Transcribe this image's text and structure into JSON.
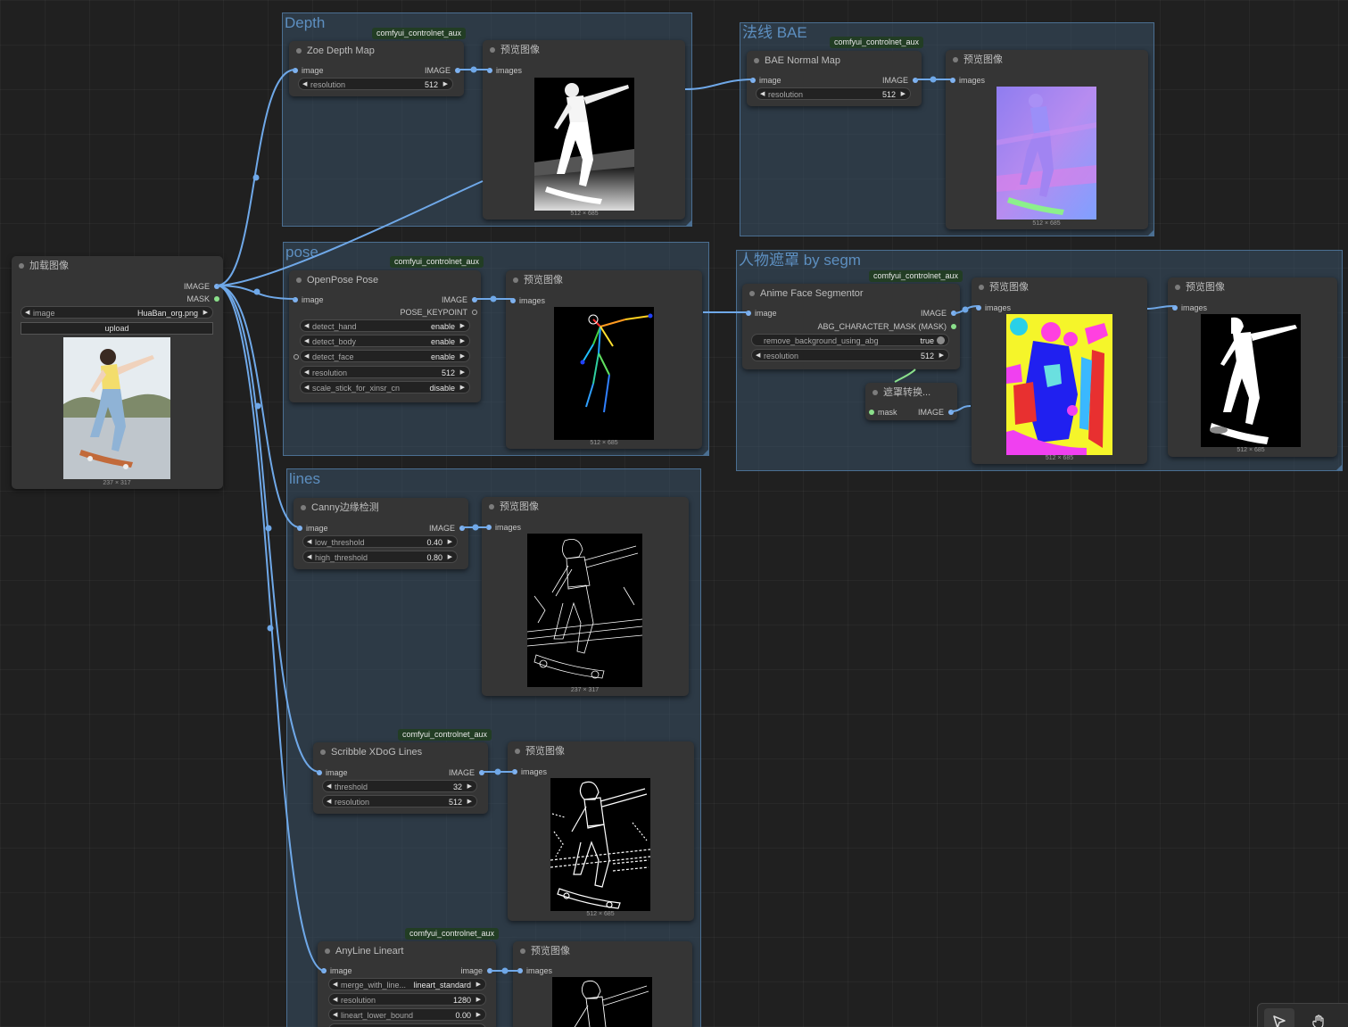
{
  "colors": {
    "canvas": "#202020",
    "group": "#395066",
    "group_title": "#5d8fc0",
    "node": "#353535",
    "link": "#6fa8e8",
    "badge": "#223d24"
  },
  "groups": {
    "depth": "Depth",
    "normal": "法线 BAE",
    "pose": "pose",
    "segm": "人物遮罩 by segm",
    "lines": "lines"
  },
  "badges": {
    "depth": "comfyui_controlnet_aux",
    "normal": "comfyui_controlnet_aux",
    "pose": "comfyui_controlnet_aux",
    "segm": "comfyui_controlnet_aux",
    "scribble": "comfyui_controlnet_aux",
    "anyline": "comfyui_controlnet_aux"
  },
  "load": {
    "title": "加载图像",
    "out_image": "IMAGE",
    "out_mask": "MASK",
    "image_label": "image",
    "image_value": "HuaBan_org.png",
    "upload": "upload",
    "dims": "237 × 317"
  },
  "zoe": {
    "title": "Zoe Depth Map",
    "in_image": "image",
    "out_image": "IMAGE",
    "res_label": "resolution",
    "res_value": "512"
  },
  "preview_depth": {
    "title": "预览图像",
    "in": "images",
    "dims": "512 × 685"
  },
  "bae": {
    "title": "BAE Normal Map",
    "in_image": "image",
    "out_image": "IMAGE",
    "res_label": "resolution",
    "res_value": "512"
  },
  "preview_normal": {
    "title": "预览图像",
    "in": "images",
    "dims": "512 × 685"
  },
  "openpose": {
    "title": "OpenPose Pose",
    "in_image": "image",
    "out_image": "IMAGE",
    "out_kp": "POSE_KEYPOINT",
    "w": [
      {
        "l": "detect_hand",
        "v": "enable"
      },
      {
        "l": "detect_body",
        "v": "enable"
      },
      {
        "l": "detect_face",
        "v": "enable"
      },
      {
        "l": "resolution",
        "v": "512"
      },
      {
        "l": "scale_stick_for_xinsr_cn",
        "v": "disable"
      }
    ]
  },
  "preview_pose": {
    "title": "预览图像",
    "in": "images",
    "dims": "512 × 685"
  },
  "anime": {
    "title": "Anime Face Segmentor",
    "in_image": "image",
    "out_image": "IMAGE",
    "out_mask": "ABG_CHARACTER_MASK (MASK)",
    "rb_label": "remove_background_using_abg",
    "rb_value": "true",
    "res_label": "resolution",
    "res_value": "512"
  },
  "convert": {
    "title": "遮罩转换...",
    "in": "mask",
    "out": "IMAGE"
  },
  "preview_segm1": {
    "title": "预览图像",
    "in": "images",
    "dims": "512 × 685"
  },
  "preview_segm2": {
    "title": "预览图像",
    "in": "images",
    "dims": "512 × 685"
  },
  "canny": {
    "title": "Canny边缘检测",
    "in_image": "image",
    "out_image": "IMAGE",
    "lo_label": "low_threshold",
    "lo_value": "0.40",
    "hi_label": "high_threshold",
    "hi_value": "0.80"
  },
  "preview_canny": {
    "title": "预览图像",
    "in": "images",
    "dims": "237 × 317"
  },
  "scribble": {
    "title": "Scribble XDoG Lines",
    "in_image": "image",
    "out_image": "IMAGE",
    "th_label": "threshold",
    "th_value": "32",
    "res_label": "resolution",
    "res_value": "512"
  },
  "preview_scribble": {
    "title": "预览图像",
    "in": "images",
    "dims": "512 × 685"
  },
  "anyline": {
    "title": "AnyLine Lineart",
    "in_image": "image",
    "out_image": "image",
    "merge_label": "merge_with_line...",
    "merge_value": "lineart_standard",
    "res_label": "resolution",
    "res_value": "1280",
    "lb_label": "lineart_lower_bound",
    "lb_value": "0.00"
  },
  "preview_anyline": {
    "title": "预览图像",
    "in": "images"
  },
  "toolbar": {
    "select": "select-pointer-icon",
    "pan": "hand-pan-icon"
  }
}
